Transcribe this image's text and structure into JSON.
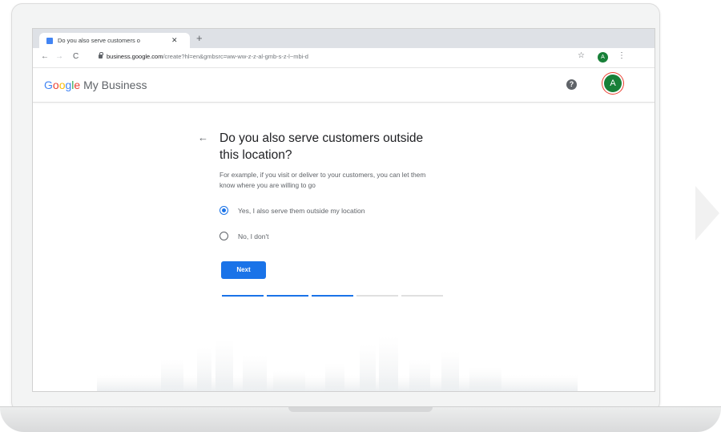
{
  "browser": {
    "tab_title": "Do you also serve customers o",
    "tab_close": "✕",
    "new_tab": "+",
    "back": "←",
    "forward": "→",
    "reload": "C",
    "url_domain": "business.google.com",
    "url_path": "/create?hl=en&gmbsrc=ww-ww-z-z-al-gmb-s-z-l~mbi-d",
    "star": "☆",
    "avatar_letter": "A",
    "menu": "⋮"
  },
  "app": {
    "logo_letters": [
      "G",
      "o",
      "o",
      "g",
      "l",
      "e"
    ],
    "logo_suffix": " My Business",
    "help": "?",
    "avatar_letter": "A"
  },
  "form": {
    "back_arrow": "←",
    "question": "Do you also serve customers outside this location?",
    "helper": "For example, if you visit or deliver to your customers, you can let them know where you are willing to go",
    "options": [
      {
        "label": "Yes, I also serve them outside my location",
        "checked": true
      },
      {
        "label": "No, I don't",
        "checked": false
      }
    ],
    "next_label": "Next",
    "progress": {
      "total_steps": 5,
      "completed_steps": 3,
      "active_color": "#1a73e8",
      "inactive_color": "#e0e0e0"
    }
  }
}
